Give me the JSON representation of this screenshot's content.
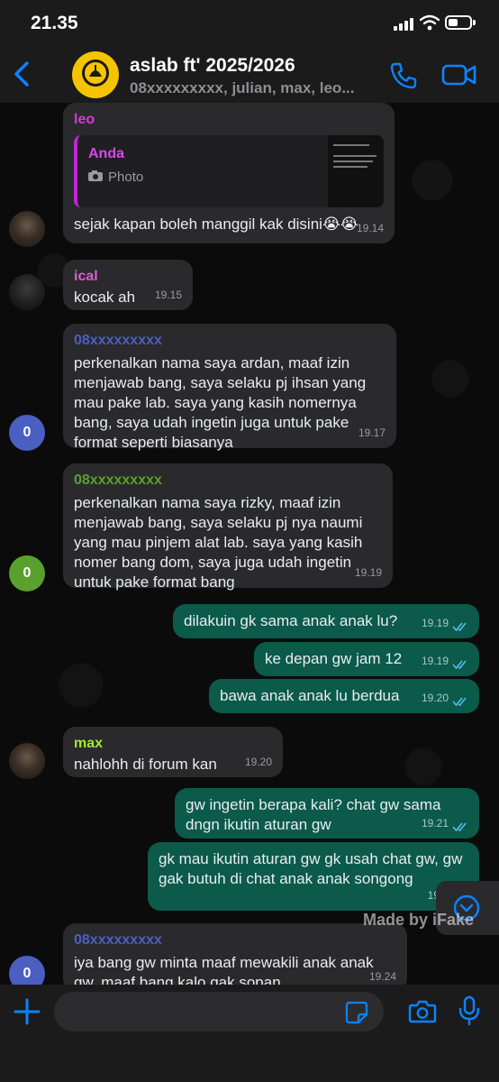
{
  "status_bar": {
    "time": "21.35"
  },
  "header": {
    "title": "aslab ft' 2025/2026",
    "subtitle": "08xxxxxxxxx, julian, max, leo...",
    "avatar_text": "UNIVERSITAS INDONESIA"
  },
  "colors": {
    "accent": "#0a84ff",
    "incoming_bubble": "#2a2a2c",
    "outgoing_bubble": "#0b5a4a",
    "sender_leo": "#d63ad6",
    "sender_ical": "#e05ad6",
    "sender_ardan": "#4a5fc1",
    "sender_rizky": "#5aa02c",
    "sender_max": "#a3e635"
  },
  "messages": [
    {
      "sender": "leo",
      "quote": {
        "name": "Anda",
        "type": "Photo"
      },
      "text": "sejak kapan boleh manggil kak disini😭😭",
      "time": "19.14"
    },
    {
      "sender": "ical",
      "text": "kocak ah",
      "time": "19.15"
    },
    {
      "sender": "08xxxxxxxxx",
      "avatar_letter": "0",
      "text": "perkenalkan nama saya ardan, maaf izin menjawab bang, saya selaku pj ihsan yang mau pake lab. saya yang kasih nomernya bang, saya udah ingetin juga untuk pake format seperti biasanya",
      "time": "19.17"
    },
    {
      "sender": "08xxxxxxxxx",
      "avatar_letter": "0",
      "text": "perkenalkan nama saya rizky, maaf izin menjawab bang, saya selaku pj nya naumi yang mau pinjem alat lab. saya yang kasih nomer bang dom, saya juga udah ingetin untuk pake format bang",
      "time": "19.19"
    },
    {
      "outgoing": true,
      "text": "dilakuin gk sama anak anak lu?",
      "time": "19.19"
    },
    {
      "outgoing": true,
      "text": "ke depan gw jam 12",
      "time": "19.19"
    },
    {
      "outgoing": true,
      "text": "bawa anak anak lu berdua",
      "time": "19.20"
    },
    {
      "sender": "max",
      "text": "nahlohh di forum kan",
      "time": "19.20"
    },
    {
      "outgoing": true,
      "text": "gw ingetin berapa kali? chat gw sama dngn ikutin aturan gw",
      "time": "19.21"
    },
    {
      "outgoing": true,
      "text": "gk mau ikutin aturan gw gk usah chat gw, gw gak butuh di chat anak anak songong",
      "time": "19.2"
    },
    {
      "sender": "08xxxxxxxxx",
      "avatar_letter": "0",
      "text": "iya bang gw minta maaf mewakili anak anak gw, maaf bang kalo gak sopan",
      "time": "19.24"
    }
  ],
  "watermark": "Made by iFake",
  "icons": {
    "back": "chevron-left-icon",
    "call": "phone-icon",
    "video": "video-camera-icon",
    "plus": "plus-icon",
    "sticker": "sticker-icon",
    "camera": "camera-icon",
    "mic": "microphone-icon",
    "scroll": "chevron-down-circle-icon"
  }
}
